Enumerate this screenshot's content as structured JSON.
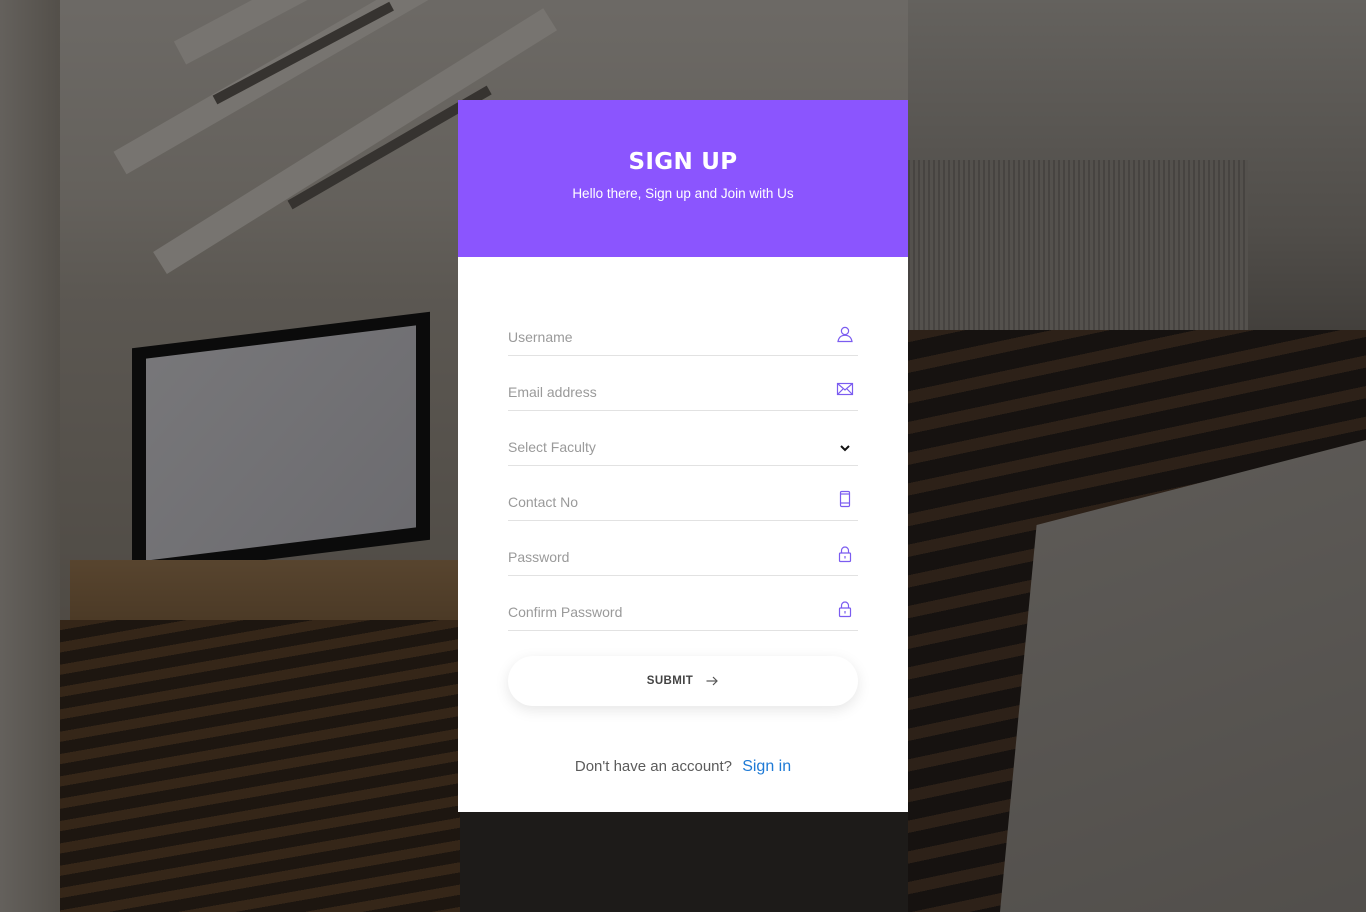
{
  "header": {
    "title": "SIGN UP",
    "subtitle": "Hello there, Sign up and Join with Us"
  },
  "form": {
    "fields": [
      {
        "placeholder": "Username",
        "icon": "user-icon"
      },
      {
        "placeholder": "Email address",
        "icon": "envelope-icon"
      },
      {
        "placeholder": "Select Faculty",
        "icon": "chevron-down-icon"
      },
      {
        "placeholder": "Contact No",
        "icon": "mobile-phone-icon"
      },
      {
        "placeholder": "Password",
        "icon": "lock-icon"
      },
      {
        "placeholder": "Confirm Password",
        "icon": "lock-icon"
      }
    ],
    "submit_label": "SUBMIT"
  },
  "footer": {
    "prompt": "Don't have an account?",
    "link_label": "Sign in"
  },
  "colors": {
    "accent": "#8b55fe",
    "link": "#1e7ad6",
    "icon": "#7b5cf0"
  }
}
